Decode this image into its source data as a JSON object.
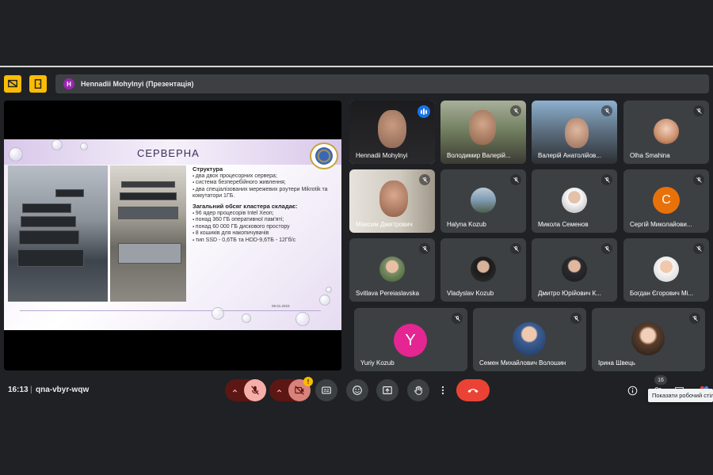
{
  "topbar": {
    "presenter_initial": "H",
    "presenter_text": "Hennadii Mohylnyi (Презентація)"
  },
  "slide": {
    "title": "СЕРВЕРНА",
    "section1_heading": "Структура",
    "section1_items": [
      "два двох процесорних сервера;",
      "система безперебійного живлення;",
      "два спеціалізованих мережевих роутери Mikrotik та комутатори 1ГБ."
    ],
    "section2_heading": "Загальний обсяг кластера складає:",
    "section2_items": [
      "96 ядер процесорів Intel Xeon;",
      "понад 360 ГБ оперативної пам'яті;",
      "понад 60 000 ГБ дискового простору",
      "8 кошиків для накопичувачів",
      "тип SSD - 0,6ТБ та HDD-9,6ТБ - 12Гб/с"
    ],
    "date": "08.01.2023"
  },
  "participants": [
    {
      "name": "Hennadii Mohylnyi",
      "kind": "video",
      "speaking": true
    },
    {
      "name": "Володимир Валерій...",
      "kind": "video",
      "muted": true
    },
    {
      "name": "Валерій Анатолійов...",
      "kind": "video",
      "muted": true
    },
    {
      "name": "Olha Smahina",
      "kind": "avatar",
      "muted": true
    },
    {
      "name": "Максим Дмитрович",
      "kind": "video",
      "muted": true
    },
    {
      "name": "Halyna Kozub",
      "kind": "avatar",
      "muted": true
    },
    {
      "name": "Микола Семенов",
      "kind": "avatar",
      "muted": true
    },
    {
      "name": "Сергій Миколайови...",
      "kind": "letter",
      "letter": "С",
      "color": "#e8710a",
      "muted": true
    },
    {
      "name": "Svitlava Pereiaslavska",
      "kind": "avatar",
      "muted": true
    },
    {
      "name": "Vladyslav Kozub",
      "kind": "avatar",
      "muted": true
    },
    {
      "name": "Дмитро Юрійович К...",
      "kind": "avatar",
      "muted": true
    },
    {
      "name": "Богдан Єгорович Мі...",
      "kind": "avatar",
      "muted": true
    },
    {
      "name": "Yuriy Kozub",
      "kind": "letter",
      "letter": "Y",
      "color": "#e52592",
      "muted": true
    },
    {
      "name": "Семен Михайлович Волошин",
      "kind": "avatar",
      "muted": true
    },
    {
      "name": "Ірина Швець",
      "kind": "avatar",
      "muted": true
    }
  ],
  "footer": {
    "time": "16:13",
    "separator": "|",
    "meeting_code": "qna-vbyr-wqw",
    "warning_badge": "!",
    "participant_count": "16",
    "tooltip": "Показати робочий стіл"
  },
  "colors": {
    "accent_blue": "#1a73e8",
    "hangup_red": "#ea4335",
    "warning_yellow": "#fbbc04",
    "tile_bg": "#3c4043"
  },
  "icons": [
    "presentation-icon",
    "door-icon",
    "mic-off-icon",
    "camera-off-icon",
    "captions-icon",
    "emoji-icon",
    "present-icon",
    "raise-hand-icon",
    "more-icon",
    "hangup-icon",
    "info-icon",
    "people-icon",
    "chat-icon",
    "activities-icon"
  ]
}
